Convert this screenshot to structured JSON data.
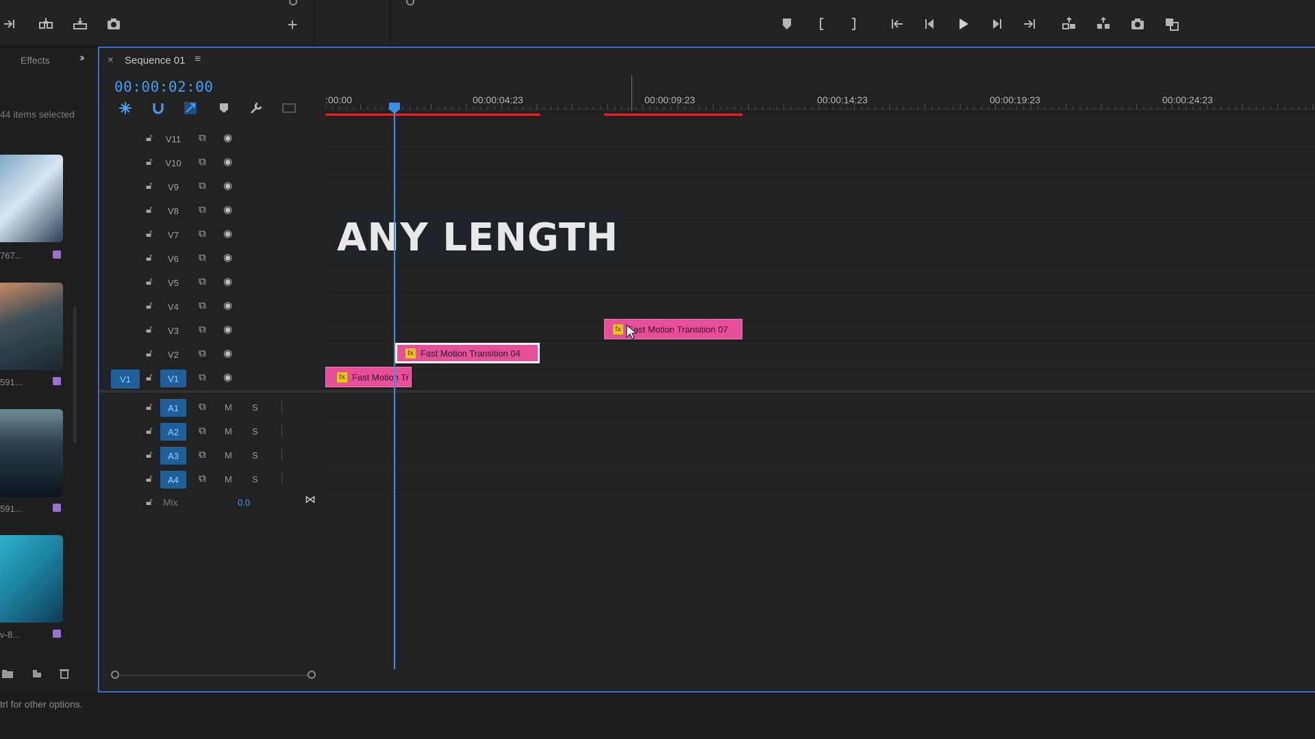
{
  "panel": {
    "effects_tab": "Effects",
    "selection_count": "44 items selected"
  },
  "thumbnails": [
    {
      "caption": "767...",
      "colors": [
        "#7ea9c8",
        "#2d3e56",
        "#d9e6f0"
      ]
    },
    {
      "caption": "591...",
      "colors": [
        "#3f4f57",
        "#c98a62",
        "#1d2730"
      ]
    },
    {
      "caption": "591...",
      "colors": [
        "#2b3e48",
        "#0e161c",
        "#6f8c99"
      ]
    },
    {
      "caption": "v-8...",
      "colors": [
        "#1b7c9c",
        "#2fb2c9",
        "#0d3c56"
      ]
    }
  ],
  "sequence": {
    "title": "Sequence 01",
    "timecode": "00:00:02:00"
  },
  "ruler": {
    "labels": [
      ":00:00",
      "00:00:04:23",
      "00:00:09:23",
      "00:00:14:23",
      "00:00:19:23",
      "00:00:24:23"
    ]
  },
  "video_tracks": [
    {
      "name": "V11",
      "active": false
    },
    {
      "name": "V10",
      "active": false
    },
    {
      "name": "V9",
      "active": false
    },
    {
      "name": "V8",
      "active": false
    },
    {
      "name": "V7",
      "active": false
    },
    {
      "name": "V6",
      "active": false
    },
    {
      "name": "V5",
      "active": false
    },
    {
      "name": "V4",
      "active": false
    },
    {
      "name": "V3",
      "active": false
    },
    {
      "name": "V2",
      "active": false
    },
    {
      "name": "V1",
      "active": true
    }
  ],
  "source_patch": "V1",
  "audio_tracks": [
    {
      "name": "A1",
      "m": "M",
      "s": "S"
    },
    {
      "name": "A2",
      "m": "M",
      "s": "S"
    },
    {
      "name": "A3",
      "m": "M",
      "s": "S"
    },
    {
      "name": "A4",
      "m": "M",
      "s": "S"
    }
  ],
  "mix": {
    "label": "Mix",
    "value": "0.0"
  },
  "clips": {
    "v3": {
      "label": "Fast Motion Transition 07",
      "fx": "fx"
    },
    "v2": {
      "label": "Fast Motion Transition 04",
      "fx": "fx"
    },
    "v1": {
      "label": "Fast Motion Tr",
      "fx": "fx"
    }
  },
  "overlay": {
    "text": "ANY LENGTH"
  },
  "status": {
    "text": "trl for other options."
  },
  "accent": {
    "timecode": "#3ea0ff",
    "clip": "#e84f9b",
    "workarea": "#e0272b",
    "active_track": "#1f5f9a"
  }
}
